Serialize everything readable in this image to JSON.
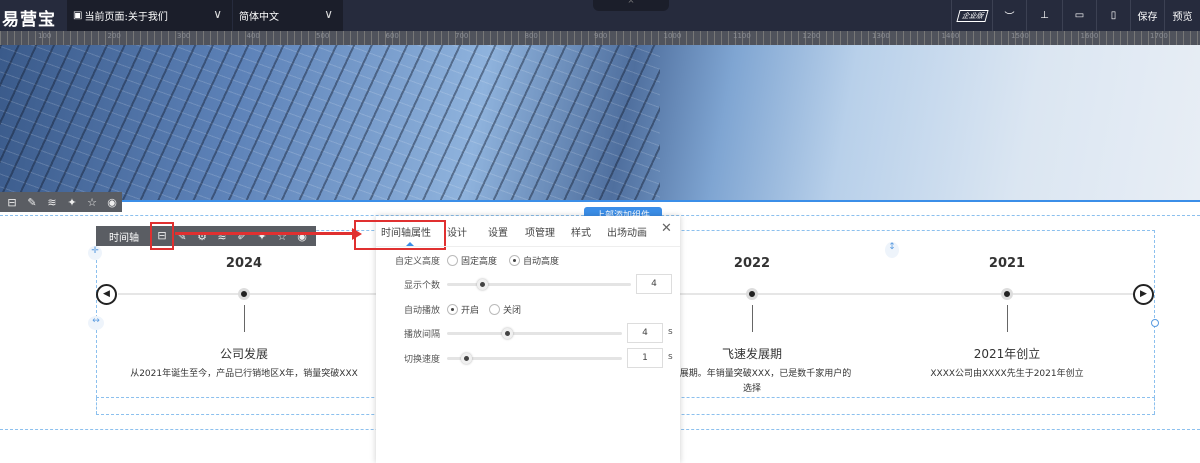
{
  "topbar": {
    "logo": "易营宝",
    "page_selector": "当前页面:关于我们",
    "language": "简体中文",
    "edition_badge": "企业版",
    "save": "保存",
    "preview": "预览"
  },
  "ruler": {
    "labels": [
      "100",
      "200",
      "300",
      "400",
      "500",
      "600",
      "700",
      "800",
      "900",
      "1000",
      "1100",
      "1200",
      "1300",
      "1400",
      "1500",
      "1600",
      "1700"
    ]
  },
  "add_component_button": "上部添加组件",
  "timeline_toolbar": {
    "label": "时间轴"
  },
  "timeline": {
    "items": [
      {
        "year": "2024",
        "title": "公司发展",
        "desc": "从2021年诞生至今，产品已行销地区X年，销量突破XXX"
      },
      {
        "year": "2022",
        "title": "飞速发展期",
        "desc": "飞速发展期。年销量突破XXX，已是数千家用户的选择"
      },
      {
        "year": "2021",
        "title": "2021年创立",
        "desc": "XXXX公司由XXXX先生于2021年创立"
      }
    ]
  },
  "panel": {
    "tabs": [
      "时间轴属性",
      "设计",
      "设置",
      "项管理",
      "样式",
      "出场动画"
    ],
    "active_tab": "时间轴属性",
    "height": {
      "label": "自定义高度",
      "options": [
        "固定高度",
        "自动高度"
      ],
      "selected": "自动高度"
    },
    "count": {
      "label": "显示个数",
      "value": "4",
      "fraction": 0.19
    },
    "autoplay": {
      "label": "自动播放",
      "options": [
        "开启",
        "关闭"
      ],
      "selected": "开启"
    },
    "interval": {
      "label": "播放间隔",
      "value": "4",
      "unit": "s",
      "fraction": 0.34
    },
    "speed": {
      "label": "切换速度",
      "value": "1",
      "unit": "s",
      "fraction": 0.11
    }
  }
}
